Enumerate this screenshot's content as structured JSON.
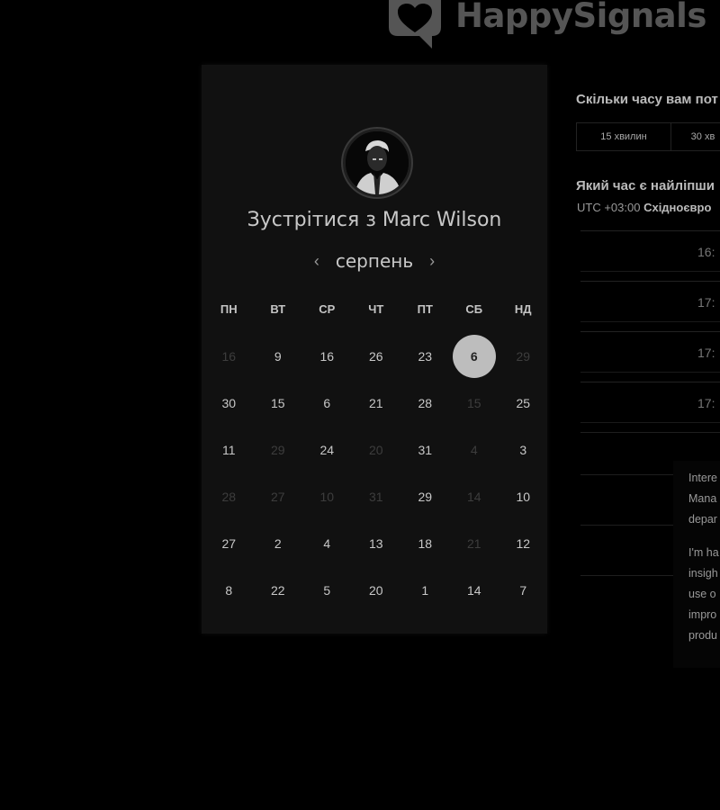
{
  "brand": {
    "name": "HappySignals"
  },
  "scheduler": {
    "title": "Зустрітися з Marc Wilson",
    "month": "серпень",
    "prev_icon": "chevron-left-icon",
    "next_icon": "chevron-right-icon",
    "weekdays": [
      "ПН",
      "ВТ",
      "СР",
      "ЧТ",
      "ПТ",
      "СБ",
      "НД"
    ],
    "weeks": [
      [
        {
          "d": "16",
          "dim": true
        },
        {
          "d": "9"
        },
        {
          "d": "16"
        },
        {
          "d": "26"
        },
        {
          "d": "23"
        },
        {
          "d": "6",
          "sel": true
        },
        {
          "d": "29",
          "dim": true
        }
      ],
      [
        {
          "d": "30"
        },
        {
          "d": "15"
        },
        {
          "d": "6"
        },
        {
          "d": "21"
        },
        {
          "d": "28"
        },
        {
          "d": "15",
          "dim": true
        },
        {
          "d": "25"
        }
      ],
      [
        {
          "d": "11"
        },
        {
          "d": "29",
          "dim": true
        },
        {
          "d": "24"
        },
        {
          "d": "20",
          "dim": true
        },
        {
          "d": "31"
        },
        {
          "d": "4",
          "dim": true
        },
        {
          "d": "3"
        }
      ],
      [
        {
          "d": "28",
          "dim": true
        },
        {
          "d": "27",
          "dim": true
        },
        {
          "d": "10",
          "dim": true
        },
        {
          "d": "31",
          "dim": true
        },
        {
          "d": "29"
        },
        {
          "d": "14",
          "dim": true
        },
        {
          "d": "10"
        }
      ],
      [
        {
          "d": "27"
        },
        {
          "d": "2"
        },
        {
          "d": "4"
        },
        {
          "d": "13"
        },
        {
          "d": "18"
        },
        {
          "d": "21",
          "dim": true
        },
        {
          "d": "12"
        }
      ],
      [
        {
          "d": "8"
        },
        {
          "d": "22"
        },
        {
          "d": "5"
        },
        {
          "d": "20"
        },
        {
          "d": "1"
        },
        {
          "d": "14"
        },
        {
          "d": "7"
        }
      ]
    ]
  },
  "booking": {
    "duration_question": "Скільки часу вам пот",
    "durations": [
      "15 хвилин",
      "30 хв"
    ],
    "time_question": "Який час є найліпши",
    "timezone_offset": "UTC +03:00",
    "timezone_name": "Східноєвро",
    "slots": [
      "16:",
      "17:",
      "17:",
      "17:"
    ]
  },
  "intro_popup": {
    "paragraph1": [
      "Intere",
      "Mana",
      "depar"
    ],
    "paragraph2": [
      "I'm ha",
      "insigh",
      "use o",
      "impro",
      "produ"
    ]
  }
}
